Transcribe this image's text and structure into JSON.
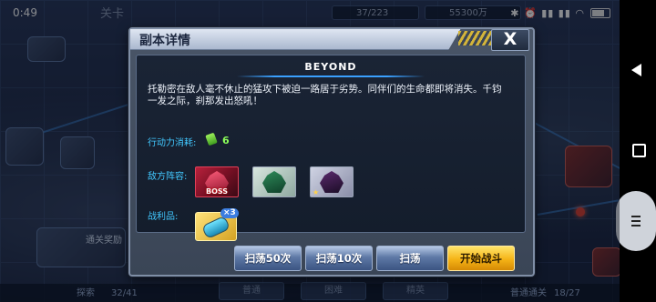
{
  "status_bar": {
    "time": "0:49",
    "icons_text": "✱ ⏰ ▮▮ ▮▮ ◠",
    "battery": "battery-icon"
  },
  "game_hud": {
    "title": "关卡",
    "res_a": "37/223",
    "res_b": "55300万",
    "bottom_tab_a": "普通",
    "bottom_tab_b": "困难",
    "bottom_tab_c": "精英",
    "bottom_left_label": "探索",
    "bottom_left_value": "32/41",
    "bottom_right_label": "普通通关",
    "bottom_right_value": "18/27",
    "left_pod_label": "通关奖励"
  },
  "dialog": {
    "title": "副本详情",
    "close_label": "X",
    "stage_name": "BEYOND",
    "description": "托勒密在敌人毫不休止的猛攻下被迫一路居于劣势。同伴们的生命都即将消失。千钧一发之际，刹那发出怒吼！",
    "cost_label": "行动力消耗:",
    "cost_value": "6",
    "enemy_label": "敌方阵容:",
    "boss_tag": "BOSS",
    "reward_label": "战利品:",
    "reward_count": "×3",
    "buttons": {
      "sweep50": "扫荡50次",
      "sweep10": "扫荡10次",
      "sweep": "扫荡",
      "start": "开始战斗"
    }
  },
  "colors": {
    "accent_cyan": "#42c8ff",
    "cost_green": "#8cff5a",
    "start_gold": "#f5b316",
    "boss_red": "#b8213c"
  }
}
